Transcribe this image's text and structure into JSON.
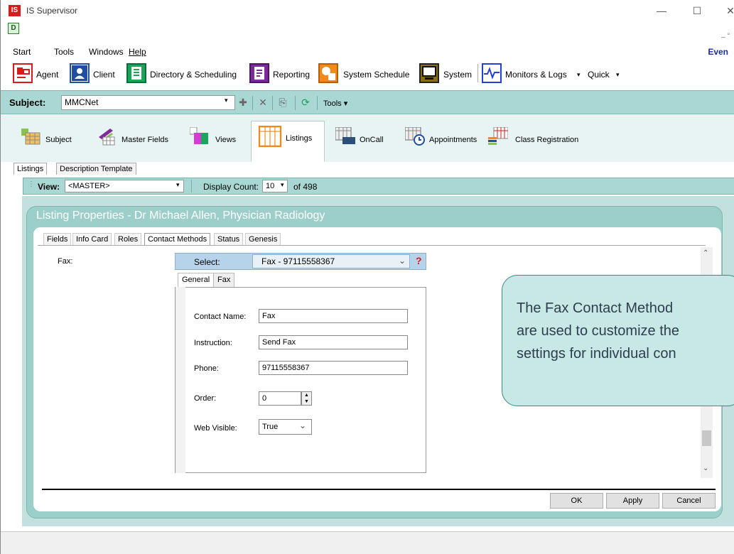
{
  "window": {
    "title": "IS Supervisor",
    "app_icon_text": "IS",
    "mdi_icon_text": "D",
    "controls": [
      "—",
      "☐",
      "✕"
    ],
    "mdi_controls": "_ ▫"
  },
  "menu": {
    "items": [
      "Start",
      "Tools",
      "Windows",
      "Help"
    ],
    "right_label": "Even"
  },
  "toolbar": {
    "items": [
      {
        "label": "Agent",
        "icon": "agent-icon",
        "color": "#d81b1b"
      },
      {
        "label": "Client",
        "icon": "client-icon",
        "color": "#1f4fa0"
      },
      {
        "label": "Directory & Scheduling",
        "icon": "directory-icon",
        "color": "#1aa55a"
      },
      {
        "label": "Reporting",
        "icon": "reporting-icon",
        "color": "#7d2a9c"
      },
      {
        "label": "System Schedule",
        "icon": "system-schedule-icon",
        "color": "#f08a1c"
      },
      {
        "label": "System",
        "icon": "system-icon",
        "color": "#8a6d1c"
      },
      {
        "label": "Monitors & Logs",
        "icon": "monitors-icon",
        "color": "#2340d8"
      },
      {
        "label": "Quick",
        "icon": "",
        "color": ""
      }
    ]
  },
  "subject": {
    "label": "Subject:",
    "value": "MMCNet",
    "tools_label": "Tools"
  },
  "module_tabs": [
    {
      "label": "Subject"
    },
    {
      "label": "Master Fields"
    },
    {
      "label": "Views"
    },
    {
      "label": "Listings",
      "active": true
    },
    {
      "label": "OnCall"
    },
    {
      "label": "Appointments"
    },
    {
      "label": "Class Registration"
    }
  ],
  "sub_tabs": [
    {
      "label": "Listings",
      "active": true
    },
    {
      "label": "Description Template"
    }
  ],
  "view_bar": {
    "view_label": "View:",
    "view_value": "<MASTER>",
    "display_count_label": "Display Count:",
    "display_count_value": "10",
    "of_total": "of 498"
  },
  "listing_properties": {
    "title": "Listing Properties - Dr Michael Allen, Physician Radiology",
    "tabs": [
      "Fields",
      "Info Card",
      "Roles",
      "Contact Methods",
      "Status",
      "Genesis"
    ],
    "active_tab": "Contact Methods",
    "fax_label": "Fax:",
    "select_label": "Select:",
    "select_value": "Fax - 97115558367",
    "help_mark": "?",
    "inner_tabs": [
      "General",
      "Fax"
    ],
    "form": {
      "contact_name_label": "Contact Name:",
      "contact_name_value": "Fax",
      "instruction_label": "Instruction:",
      "instruction_value": "Send Fax",
      "phone_label": "Phone:",
      "phone_value": "97115558367",
      "order_label": "Order:",
      "order_value": "0",
      "web_visible_label": "Web Visible:",
      "web_visible_value": "True"
    },
    "buttons": {
      "ok": "OK",
      "apply": "Apply",
      "cancel": "Cancel"
    }
  },
  "callout": {
    "lines": [
      "The Fax Contact Method",
      "are used to customize the",
      "settings for individual con"
    ]
  }
}
